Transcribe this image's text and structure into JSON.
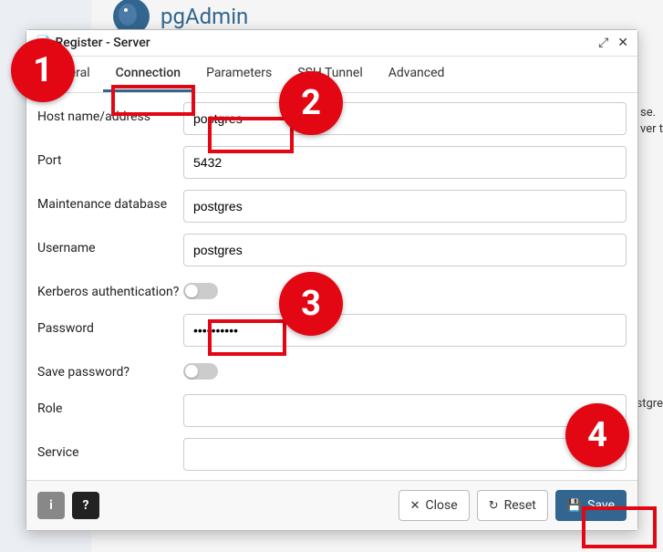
{
  "background": {
    "app_name": "pgAdmin",
    "side_text_1": "se.",
    "side_text_2": "ver t",
    "side_text_3": "stgre"
  },
  "dialog": {
    "title_prefix": "Register - Server",
    "tabs": {
      "general": "General",
      "connection": "Connection",
      "parameters": "Parameters",
      "ssh": "SSH Tunnel",
      "advanced": "Advanced"
    },
    "fields": {
      "host_label": "Host name/address",
      "host_value": "postgres",
      "port_label": "Port",
      "port_value": "5432",
      "maint_label": "Maintenance database",
      "maint_value": "postgres",
      "user_label": "Username",
      "user_value": "postgres",
      "kerb_label": "Kerberos authentication?",
      "pass_label": "Password",
      "pass_value": "••••••••••",
      "savepw_label": "Save password?",
      "role_label": "Role",
      "role_value": "",
      "service_label": "Service",
      "service_value": ""
    },
    "footer": {
      "close": "Close",
      "reset": "Reset",
      "save": "Save"
    }
  },
  "annotations": {
    "n1": "1",
    "n2": "2",
    "n3": "3",
    "n4": "4"
  }
}
